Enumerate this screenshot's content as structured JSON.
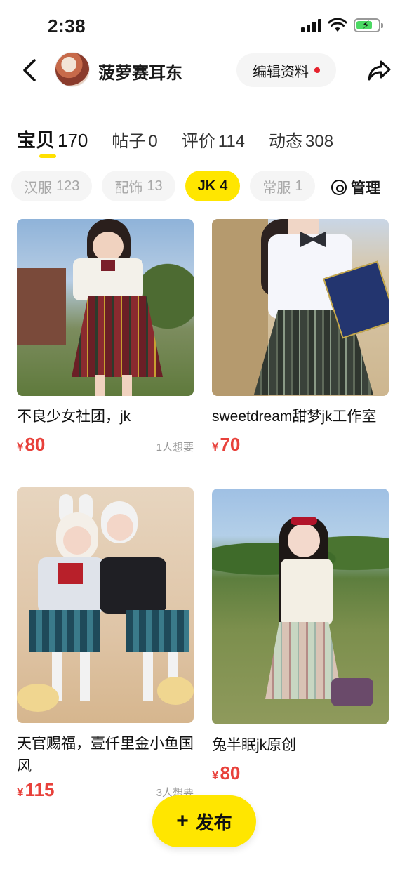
{
  "status_bar": {
    "time": "2:38"
  },
  "header": {
    "username": "菠萝赛耳东",
    "edit_button_label": "编辑资料"
  },
  "main_tabs": [
    {
      "label": "宝贝",
      "count": "170",
      "active": true
    },
    {
      "label": "帖子",
      "count": "0"
    },
    {
      "label": "评价",
      "count": "114"
    },
    {
      "label": "动态",
      "count": "308"
    }
  ],
  "sub_tabs": [
    {
      "label": "汉服",
      "count": "123"
    },
    {
      "label": "配饰",
      "count": "13"
    },
    {
      "label": "JK",
      "count": "4",
      "active": true
    },
    {
      "label": "常服",
      "count": "1"
    }
  ],
  "manage_label": "管理",
  "products": [
    {
      "title": "不良少女社团，jk",
      "currency": "¥",
      "price": "80",
      "wants": "1人想要"
    },
    {
      "title": "sweetdream甜梦jk工作室",
      "currency": "¥",
      "price": "70",
      "wants": ""
    },
    {
      "title": "天官赐福，壹仟里金小鱼国风",
      "currency": "¥",
      "price": "115",
      "wants": "3人想要"
    },
    {
      "title": "兔半眠jk原创",
      "currency": "¥",
      "price": "80",
      "wants": ""
    }
  ],
  "publish_label": "发布",
  "colors": {
    "accent": "#ffe600",
    "price": "#e8413b",
    "chip_bg": "#f5f5f5"
  }
}
